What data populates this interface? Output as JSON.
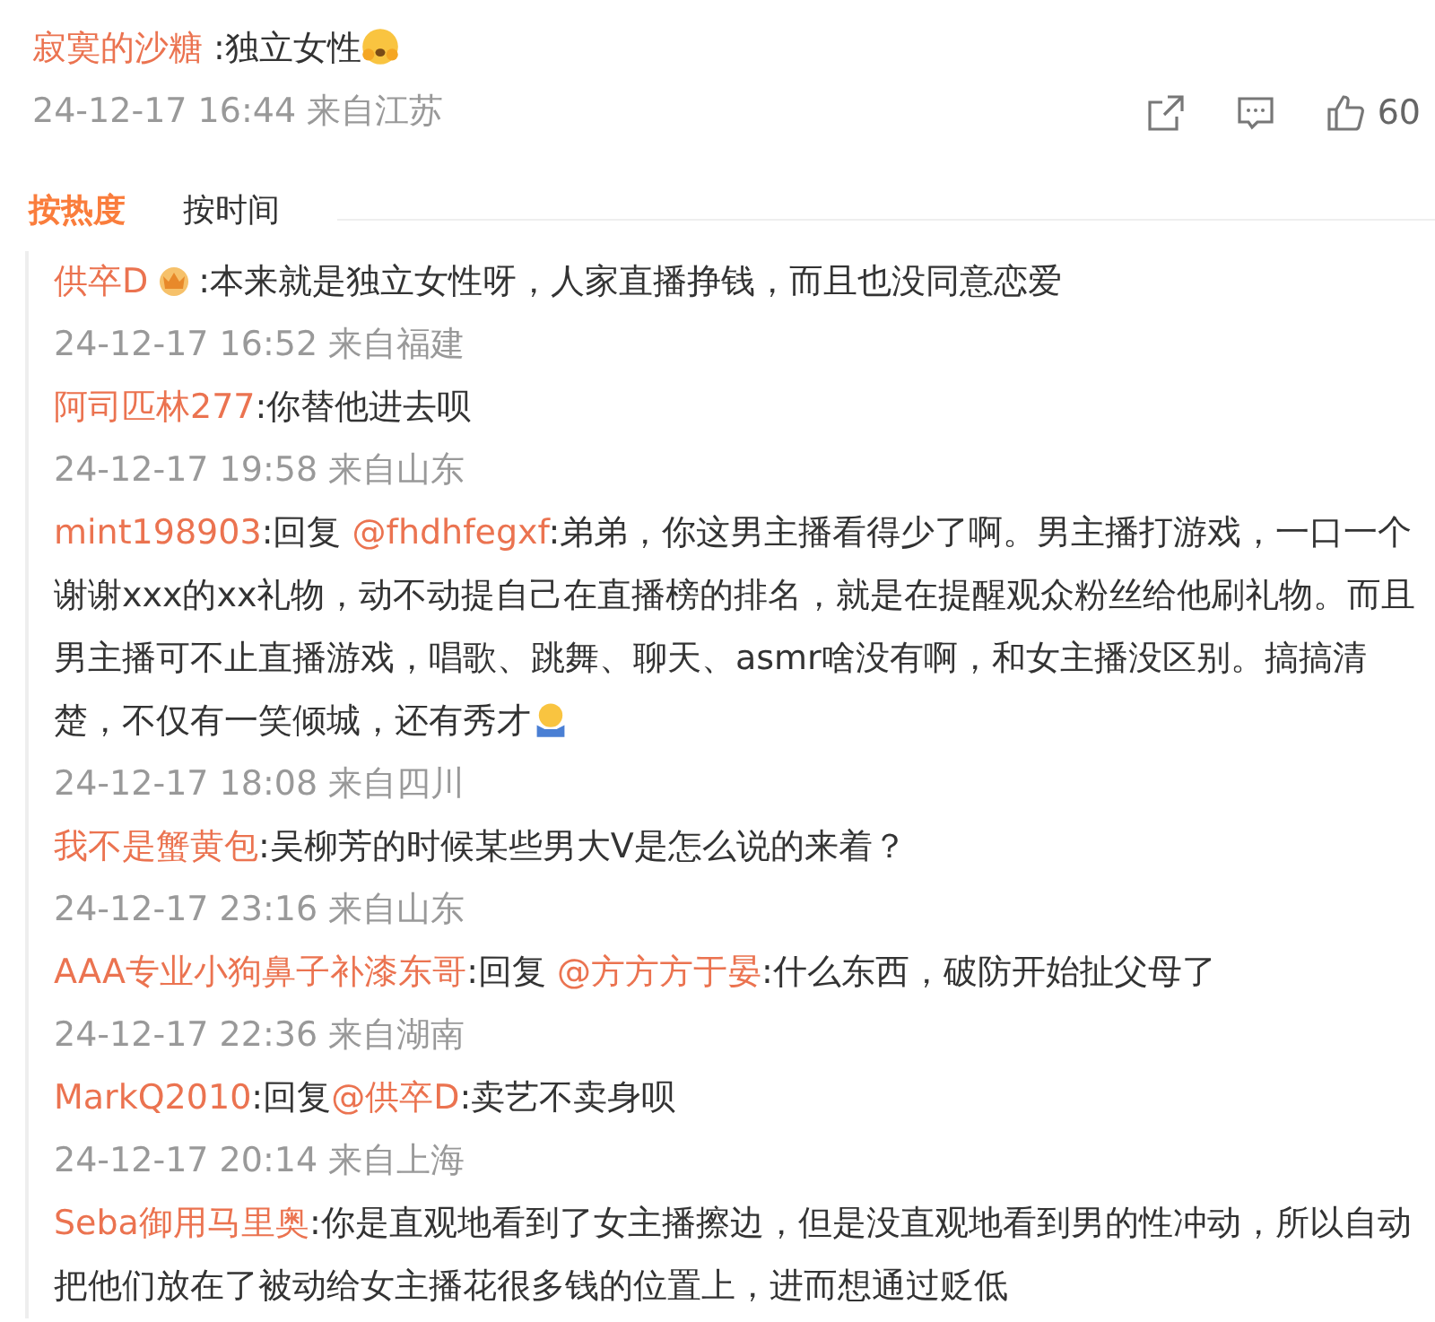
{
  "post": {
    "user": "寂寞的沙糖",
    "text": ":独立女性",
    "emoji": true,
    "time": "24-12-17 16:44",
    "location": "来自江苏",
    "likes": "60"
  },
  "sort_tabs": [
    {
      "label": "按热度",
      "selected": true
    },
    {
      "label": "按时间",
      "selected": false
    }
  ],
  "replies": [
    {
      "user": "供卒D",
      "badge": true,
      "text": ":本来就是独立女性呀，人家直播挣钱，而且也没同意恋爱",
      "time": "24-12-17 16:52",
      "location": "来自福建"
    },
    {
      "user": "阿司匹林277",
      "text": ":你替他进去呗",
      "time": "24-12-17 19:58",
      "location": "来自山东"
    },
    {
      "user": "mint198903",
      "reply_label": ":回复 ",
      "mention": "@fhdhfegxf",
      "text": ":弟弟，你这男主播看得少了啊。男主播打游戏，一口一个谢谢xxx的xx礼物，动不动提自己在直播榜的排名，就是在提醒观众粉丝给他刷礼物。而且男主播可不止直播游戏，唱歌、跳舞、聊天、asmr啥没有啊，和女主播没区别。搞搞清楚，不仅有一笑倾城，还有秀才",
      "emoji": true,
      "time": "24-12-17 18:08",
      "location": "来自四川"
    },
    {
      "user": "我不是蟹黄包",
      "text": ":吴柳芳的时候某些男大V是怎么说的来着？",
      "time": "24-12-17 23:16",
      "location": "来自山东"
    },
    {
      "user": "AAA专业小狗鼻子补漆东哥",
      "reply_label": ":回复 ",
      "mention": "@方方方于晏",
      "text": ":什么东西，破防开始扯父母了",
      "time": "24-12-17 22:36",
      "location": "来自湖南"
    },
    {
      "user": "MarkQ2010",
      "reply_label": ":回复",
      "mention": "@供卒D",
      "text": ":卖艺不卖身呗",
      "time": "24-12-17 20:14",
      "location": "来自上海"
    },
    {
      "user": "Seba御用马里奥",
      "text": ":你是直观地看到了女主播擦边，但是没直观地看到男的性冲动，所以自动把他们放在了被动给女主播花很多钱的位置上，进而想通过贬低"
    }
  ]
}
